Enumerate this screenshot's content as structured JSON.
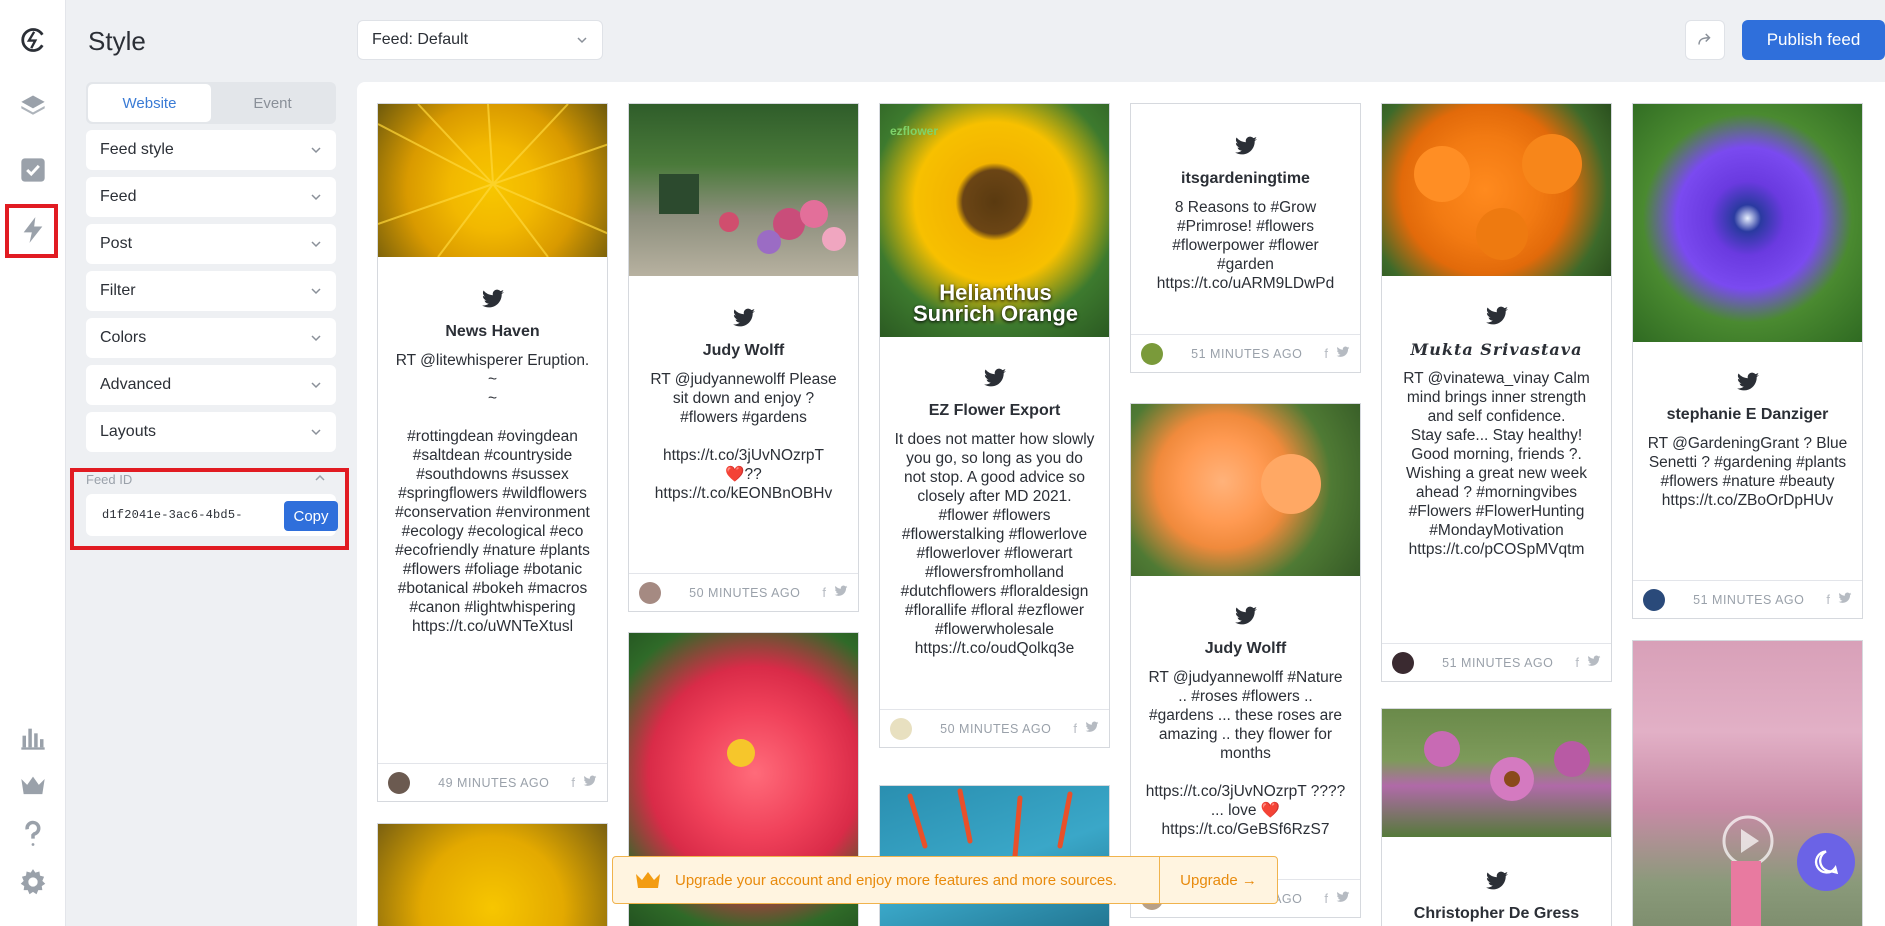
{
  "panel": {
    "title": "Style",
    "mode_tabs": [
      "Website",
      "Event"
    ],
    "sections": [
      "Feed style",
      "Feed",
      "Post",
      "Filter",
      "Colors",
      "Advanced",
      "Layouts"
    ],
    "feed_id_label": "Feed ID",
    "feed_id_value": "d1f2041e-3ac6-4bd5-",
    "copy_label": "Copy"
  },
  "topbar": {
    "feed_select": "Feed: Default",
    "publish_label": "Publish feed"
  },
  "rail": [
    "logo-icon",
    "layers-icon",
    "checkbox-icon",
    "bolt-icon",
    "stats-icon",
    "crown-icon",
    "help-icon",
    "gear-icon"
  ],
  "posts": [
    {
      "author": "News Haven",
      "text": "RT @litewhisperer Eruption.\n~\n~\n\n#rottingdean #ovingdean #saltdean #countryside #southdowns #sussex #springflowers #wildflowers #conservation #environment #ecology #ecological #eco #ecofriendly #nature #plants #flowers #foliage #botanic #botanical #bokeh #macros #canon #lightwhispering https://t.co/uWNTeXtusl",
      "time": "49 MINUTES AGO"
    },
    {
      "author": "Judy Wolff",
      "text": "RT @judyannewolff Please sit down and enjoy ? #flowers #gardens\n\nhttps://t.co/3jUvNOzrpT ❤️?? https://t.co/kEONBnOBHv",
      "time": "50 MINUTES AGO"
    },
    {
      "author": "EZ Flower Export",
      "text": "It does not matter how slowly you go, so long as you do not stop. A good advice so closely after MD 2021. #flower #flowers #flowerstalking #flowerlove #flowerlover #flowerart #flowersfromholland #dutchflowers #floraldesign #florallife #floral #ezflower #flowerwholesale https://t.co/oudQolkq3e",
      "time": "50 MINUTES AGO",
      "image_caption": "Helianthus\nSunrich Orange",
      "image_brand": "ezflower"
    },
    {
      "author": "itsgardeningtime",
      "text": "8 Reasons to #Grow #Primrose! #flowers #flowerpower #flower #garden https://t.co/uARM9LDwPd",
      "time": "51 MINUTES AGO"
    },
    {
      "author": "Judy Wolff",
      "text": "RT @judyannewolff #Nature .. #roses #flowers .. #gardens ... these roses are amazing .. they flower for months\n\nhttps://t.co/3jUvNOzrpT ???? ... love ❤️ https://t.co/GeBSf6RzS7",
      "time": "51 MINUTES AGO"
    },
    {
      "author": "Mukta Srivastava",
      "text": "RT @vinatewa_vinay Calm mind brings inner strength and self confidence.\nStay safe... Stay healthy! Good morning, friends ?. Wishing a great new week ahead ? #morningvibes #Flowers #FlowerHunting #MondayMotivation https://t.co/pCOSpMVqtm",
      "time": "51 MINUTES AGO"
    },
    {
      "author": "Christopher De Gress"
    },
    {
      "author": "stephanie E Danziger",
      "text": "RT @GardeningGrant ? Blue Senetti ? #gardening #plants #flowers #nature #beauty https://t.co/ZBoOrDpHUv",
      "time": "51 MINUTES AGO"
    }
  ],
  "upgrade": {
    "text": "Upgrade your account and enjoy more features and more sources.",
    "button": "Upgrade →"
  },
  "colors": {
    "accent": "#2f6fdb",
    "highlight": "#e11b22",
    "upgrade": "#e88a0c"
  }
}
